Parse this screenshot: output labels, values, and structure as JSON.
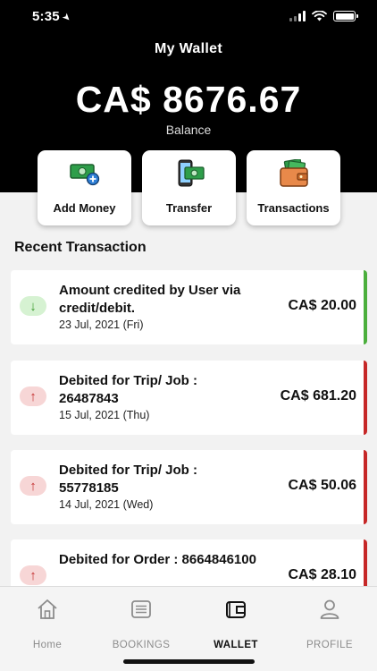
{
  "status": {
    "time": "5:35"
  },
  "header": {
    "title": "My Wallet",
    "balance": "CA$ 8676.67",
    "balance_label": "Balance"
  },
  "actions": [
    {
      "label": "Add Money",
      "icon": "add-money-icon"
    },
    {
      "label": "Transfer",
      "icon": "transfer-icon"
    },
    {
      "label": "Transactions",
      "icon": "wallet-icon"
    }
  ],
  "recent": {
    "title": "Recent Transaction",
    "items": [
      {
        "type": "credit",
        "title": "Amount credited by User via credit/debit.",
        "date": "23 Jul, 2021 (Fri)",
        "amount": "CA$ 20.00"
      },
      {
        "type": "debit",
        "title": "Debited for Trip/ Job : 26487843",
        "date": "15 Jul, 2021 (Thu)",
        "amount": "CA$ 681.20"
      },
      {
        "type": "debit",
        "title": "Debited for Trip/ Job : 55778185",
        "date": "14 Jul, 2021 (Wed)",
        "amount": "CA$ 50.06"
      },
      {
        "type": "debit",
        "title": "Debited for Order : 8664846100",
        "date": "",
        "amount": "CA$ 28.10"
      }
    ]
  },
  "tabs": [
    {
      "label": "Home",
      "icon": "home-icon"
    },
    {
      "label": "BOOKINGS",
      "icon": "bookings-icon"
    },
    {
      "label": "WALLET",
      "icon": "wallet-icon",
      "active": true
    },
    {
      "label": "PROFILE",
      "icon": "profile-icon"
    }
  ],
  "colors": {
    "credit": "#4caf3d",
    "debit": "#c62828",
    "header": "#000000",
    "money_green": "#2e9e4a"
  }
}
